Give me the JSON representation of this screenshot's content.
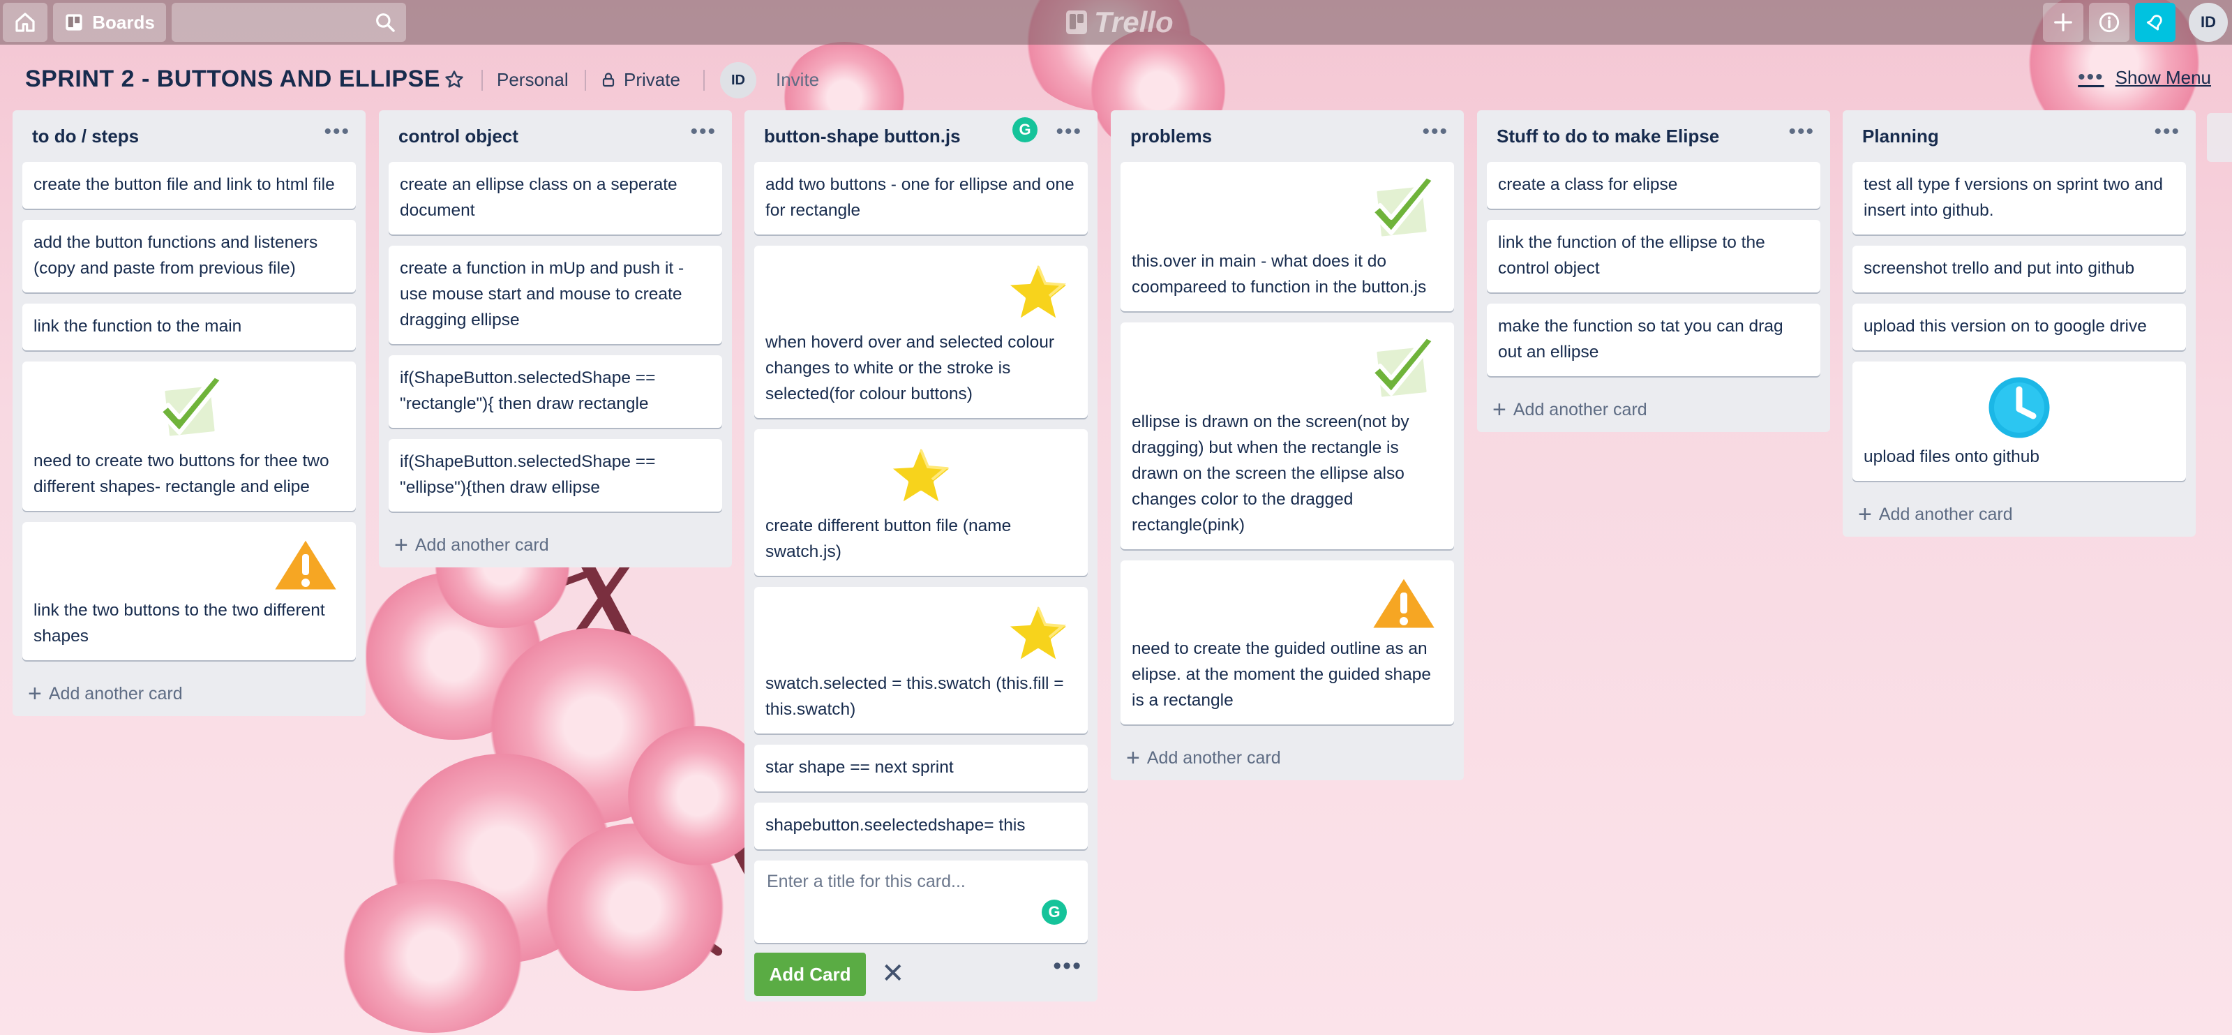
{
  "topbar": {
    "boards_label": "Boards",
    "logo_text": "Trello",
    "avatar_initials": "ID"
  },
  "board": {
    "title": "SPRINT 2 - BUTTONS AND ELLIPSE",
    "team": "Personal",
    "visibility": "Private",
    "member_initials": "ID",
    "invite_label": "Invite",
    "show_menu_label": "Show Menu"
  },
  "add_another_card_label": "Add another card",
  "lists": [
    {
      "title": "to do / steps",
      "cards": [
        {
          "text": "create the button file and link to html file"
        },
        {
          "text": "add the button functions and listeners (copy and paste from previous file)"
        },
        {
          "text": "link the function to the main"
        },
        {
          "text": "need to create two buttons for thee two different shapes- rectangle and elipe",
          "sticker": "check-sticker"
        },
        {
          "text": "link the two buttons to the two different shapes",
          "sticker": "warning-sticker"
        }
      ]
    },
    {
      "title": "control object",
      "cards": [
        {
          "text": "create an ellipse class on a seperate document"
        },
        {
          "text": "create a function in mUp and push it - use mouse start and mouse to create dragging ellipse"
        },
        {
          "text": "if(ShapeButton.selectedShape == \"rectangle\"){ then draw rectangle"
        },
        {
          "text": "if(ShapeButton.selectedShape == \"ellipse\"){then draw ellipse"
        }
      ]
    },
    {
      "title": "button-shape button.js",
      "cards": [
        {
          "text": "add two buttons - one for ellipse and one for rectangle"
        },
        {
          "text": "when hoverd over and selected colour changes to white or the stroke is selected(for colour buttons)",
          "sticker": "star-sticker"
        },
        {
          "text": "create different button file (name swatch.js)",
          "sticker": "star-sticker"
        },
        {
          "text": "swatch.selected = this.swatch (this.fill = this.swatch)",
          "sticker": "star-sticker"
        },
        {
          "text": "star shape == next sprint"
        },
        {
          "text": "shapebutton.seelectedshape= this"
        }
      ],
      "composer": {
        "placeholder": "Enter a title for this card...",
        "add_button_label": "Add Card"
      }
    },
    {
      "title": "problems",
      "cards": [
        {
          "text": "this.over in main - what does it do coompareed to function in the button.js",
          "sticker": "check-sticker"
        },
        {
          "text": "ellipse is drawn on the screen(not by dragging) but when the rectangle is drawn on the screen the ellipse also changes color to the dragged rectangle(pink)",
          "sticker": "check-sticker"
        },
        {
          "text": "need to create the guided outline as an elipse. at the moment the guided shape is a rectangle",
          "sticker": "warning-sticker"
        }
      ]
    },
    {
      "title": "Stuff to do to make Elipse",
      "cards": [
        {
          "text": "create a class for elipse"
        },
        {
          "text": "link the function of the ellipse to the control object"
        },
        {
          "text": "make the function so tat you can drag out an ellipse"
        }
      ]
    },
    {
      "title": "Planning",
      "cards": [
        {
          "text": "test all type f versions on sprint two and insert into github."
        },
        {
          "text": "screenshot trello and put into github"
        },
        {
          "text": "upload this version on to google drive"
        },
        {
          "text": "upload files onto github",
          "sticker": "clock-sticker"
        }
      ]
    }
  ]
}
